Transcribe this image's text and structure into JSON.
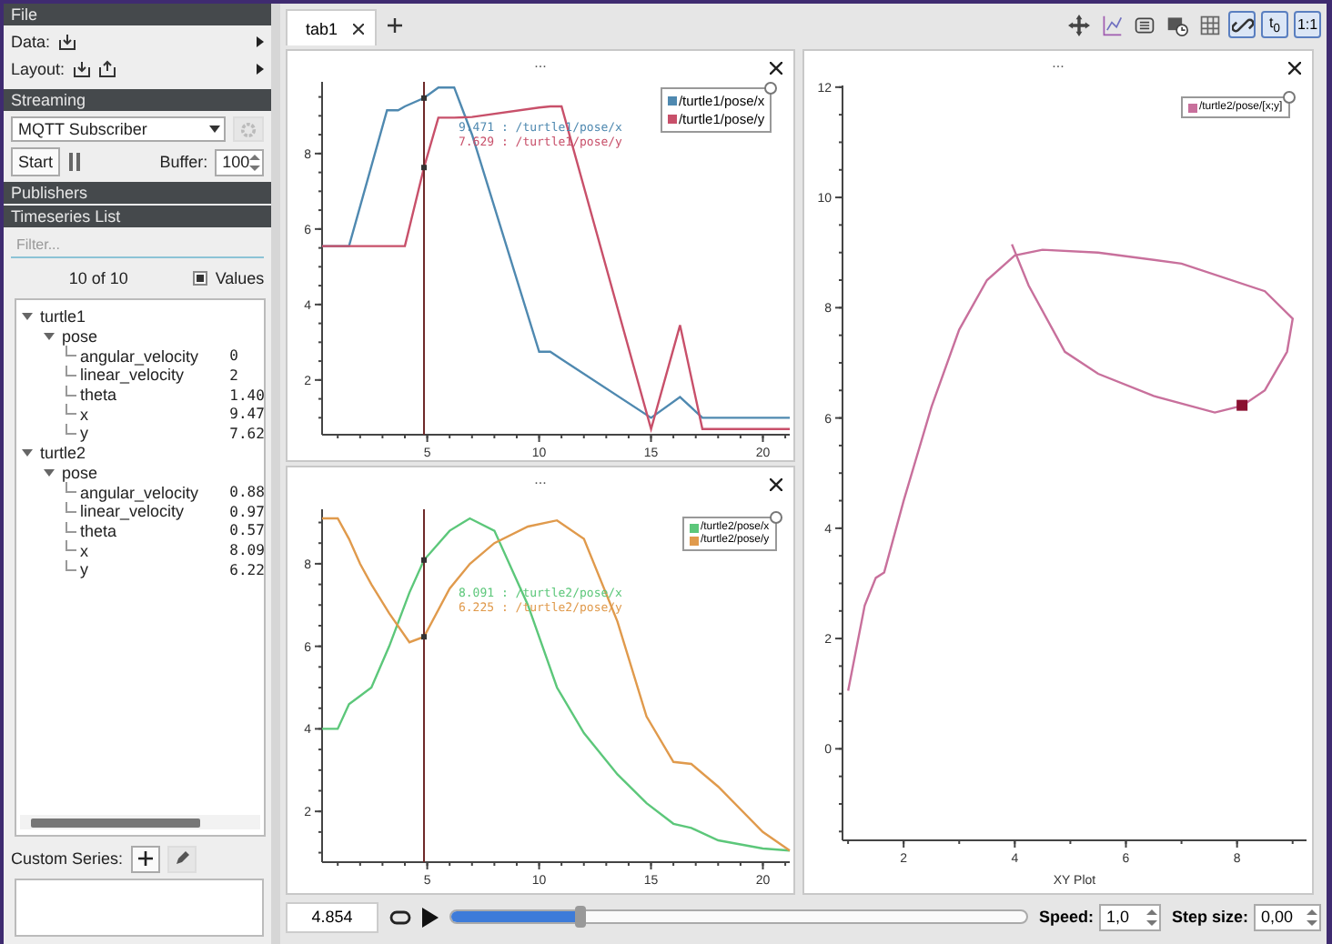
{
  "sidebar": {
    "file": {
      "title": "File",
      "rows": [
        {
          "label": "Data:"
        },
        {
          "label": "Layout:"
        }
      ]
    },
    "streaming": {
      "title": "Streaming",
      "source": "MQTT Subscriber",
      "start": "Start",
      "buffer_label": "Buffer:",
      "buffer": "100"
    },
    "publishers": {
      "title": "Publishers"
    },
    "timeseries": {
      "title": "Timeseries List",
      "filter_placeholder": "Filter...",
      "count": "10 of 10",
      "values_label": "Values",
      "values_checked": true,
      "tree": [
        {
          "label": "turtle1",
          "expanded": true,
          "children": [
            {
              "label": "pose",
              "expanded": true,
              "children": [
                {
                  "label": "angular_velocity",
                  "value": "0"
                },
                {
                  "label": "linear_velocity",
                  "value": "2"
                },
                {
                  "label": "theta",
                  "value": "1.40"
                },
                {
                  "label": "x",
                  "value": "9.47"
                },
                {
                  "label": "y",
                  "value": "7.62"
                }
              ]
            }
          ]
        },
        {
          "label": "turtle2",
          "expanded": true,
          "children": [
            {
              "label": "pose",
              "expanded": true,
              "children": [
                {
                  "label": "angular_velocity",
                  "value": "0.88"
                },
                {
                  "label": "linear_velocity",
                  "value": "0.97"
                },
                {
                  "label": "theta",
                  "value": "0.57"
                },
                {
                  "label": "x",
                  "value": "8.09"
                },
                {
                  "label": "y",
                  "value": "6.22"
                }
              ]
            }
          ]
        }
      ]
    },
    "custom_series": {
      "label": "Custom Series:"
    }
  },
  "tabs": [
    {
      "label": "tab1",
      "selected": true
    }
  ],
  "toolbar": [
    {
      "checked": false
    },
    {
      "checked": false
    },
    {
      "checked": false
    },
    {
      "checked": false
    },
    {
      "checked": false
    },
    {
      "checked": true
    },
    {
      "label": "t$_{0}$",
      "checked": true
    },
    {
      "label": "1:1",
      "checked": true
    }
  ],
  "plots": [
    {
      "title": "...",
      "tooltip": [
        {
          "text": "9.471 : /turtle1/pose/x"
        },
        {
          "text": "7.629 : /turtle1/pose/y"
        }
      ],
      "chart_data": {
        "type": "line",
        "x": [
          0.3,
          1.5,
          3.2,
          3.7,
          4.0,
          4.854,
          5.5,
          5.6,
          6.2,
          7,
          10,
          10.5,
          11,
          15,
          16.3,
          17.3,
          21.2
        ],
        "series": [
          {
            "name": "/turtle1/pose/x",
            "color": "#4f89b0",
            "values": [
              5.55,
              5.55,
              9.15,
              9.15,
              9.25,
              9.47,
              9.75,
              9.75,
              9.75,
              8.5,
              2.75,
              2.75,
              2.55,
              1.0,
              1.55,
              1.0,
              1.0
            ]
          },
          {
            "name": "/turtle1/pose/y",
            "color": "#c8506a",
            "values": [
              5.55,
              5.55,
              5.55,
              5.55,
              5.55,
              7.63,
              8.95,
              8.95,
              8.95,
              8.97,
              9.22,
              9.25,
              9.25,
              0.7,
              3.45,
              0.7,
              0.7
            ]
          }
        ],
        "xlim": [
          0.3,
          21.2
        ],
        "ylim": [
          0.55,
          9.9
        ],
        "xticks": [
          5,
          10,
          15,
          20
        ],
        "yticks": [
          2,
          4,
          6,
          8
        ],
        "ref_lines": [
          {
            "axis": "x",
            "value": 4.854
          }
        ]
      }
    },
    {
      "title": "...",
      "tooltip": [
        {
          "text": "8.091 : /turtle2/pose/x"
        },
        {
          "text": "6.225 : /turtle2/pose/y"
        }
      ],
      "chart_data": {
        "type": "line",
        "x": [
          0.3,
          1,
          1.5,
          2,
          2.5,
          3.3,
          4.2,
          4.854,
          6,
          6.9,
          8,
          9.5,
          10.8,
          12,
          13.5,
          14.8,
          16,
          16.8,
          18,
          20,
          21.2
        ],
        "series": [
          {
            "name": "/turtle2/pose/x",
            "color": "#5cc77a",
            "values": [
              4,
              4,
              4.6,
              4.8,
              5.0,
              6.0,
              7.3,
              8.09,
              8.8,
              9.1,
              8.8,
              7.0,
              5.0,
              3.9,
              2.9,
              2.2,
              1.7,
              1.6,
              1.3,
              1.1,
              1.05
            ]
          },
          {
            "name": "/turtle2/pose/y",
            "color": "#e09a4c",
            "values": [
              9.1,
              9.1,
              8.6,
              8.0,
              7.5,
              6.8,
              6.1,
              6.23,
              7.4,
              8.0,
              8.5,
              8.9,
              9.05,
              8.6,
              6.6,
              4.3,
              3.2,
              3.15,
              2.6,
              1.5,
              1.05
            ]
          }
        ],
        "xlim": [
          0.3,
          21.2
        ],
        "ylim": [
          0.77,
          9.32
        ],
        "xticks": [
          5,
          10,
          15,
          20
        ],
        "yticks": [
          2,
          4,
          6,
          8
        ],
        "ref_lines": [
          {
            "axis": "x",
            "value": 4.854
          }
        ]
      }
    },
    {
      "title": "...",
      "chart_data": {
        "type": "line",
        "xlabel": "XY Plot",
        "x": [
          1.0,
          1.3,
          1.5,
          1.65,
          2.0,
          2.5,
          3.0,
          3.5,
          4.0,
          4.5,
          5.5,
          7.0,
          8.5,
          9.0,
          8.9,
          8.5,
          8.09,
          7.6,
          6.5,
          5.5,
          4.9,
          4.25,
          3.95
        ],
        "series": [
          {
            "name": "/turtle2/pose/[x;y]",
            "color": "#c8709c",
            "values": [
              1.05,
              2.6,
              3.1,
              3.2,
              4.5,
              6.2,
              7.6,
              8.5,
              8.95,
              9.05,
              9.0,
              8.8,
              8.3,
              7.8,
              7.2,
              6.5,
              6.22,
              6.1,
              6.4,
              6.8,
              7.2,
              8.4,
              9.15
            ]
          }
        ],
        "xlim": [
          0.9,
          9.25
        ],
        "ylim": [
          -1.66,
          12.03
        ],
        "xticks": [
          2,
          4,
          6,
          8
        ],
        "yticks": [
          0,
          2,
          4,
          6,
          8,
          10,
          12
        ]
      }
    }
  ],
  "playback": {
    "time": "4.854",
    "level": 0.225,
    "speed_label": "Speed:",
    "speed": "1,0",
    "step_label": "Step size:",
    "step": "0,00"
  }
}
